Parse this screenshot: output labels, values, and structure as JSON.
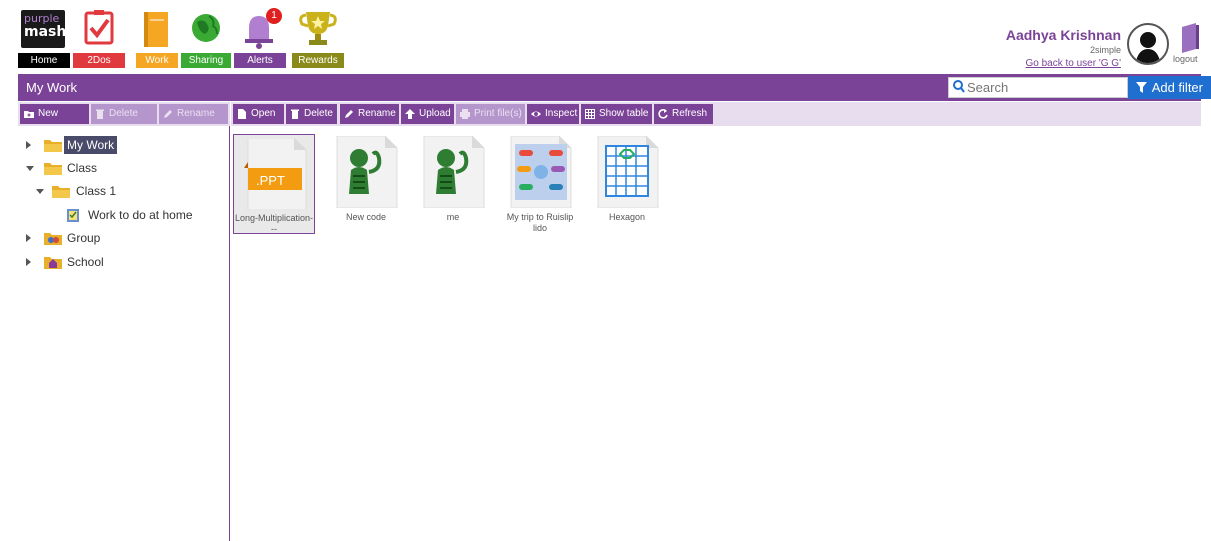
{
  "nav": {
    "items": [
      {
        "label": "Home",
        "icon": "purple-mash-logo-icon",
        "color": "#000000"
      },
      {
        "label": "2Dos",
        "icon": "checkbox-icon",
        "color": "#e03a3e"
      },
      {
        "label": "Work",
        "icon": "notebook-icon",
        "color": "#f5a623"
      },
      {
        "label": "Sharing",
        "icon": "globe-icon",
        "color": "#3aaa35"
      },
      {
        "label": "Alerts",
        "icon": "bell-icon",
        "color": "#7b4397",
        "badge": "1"
      },
      {
        "label": "Rewards",
        "icon": "trophy-icon",
        "color": "#8a8a1a"
      }
    ],
    "logo_text_top": "purple",
    "logo_text_bottom": "mash"
  },
  "user": {
    "name": "Aadhya Krishnan",
    "school": "2simple",
    "back_link": "Go back to user 'G G'",
    "logout_label": "logout"
  },
  "titlebar": {
    "title": "My Work",
    "search_placeholder": "Search",
    "add_filter_label": "Add filter"
  },
  "left_toolbar": {
    "new_label": "New",
    "delete_label": "Delete",
    "rename_label": "Rename"
  },
  "right_toolbar": {
    "open_label": "Open",
    "delete_label": "Delete",
    "rename_label": "Rename",
    "upload_label": "Upload",
    "print_label": "Print file(s)",
    "inspect_label": "Inspect",
    "show_table_label": "Show table",
    "refresh_label": "Refresh"
  },
  "tree": {
    "my_work": "My Work",
    "class": "Class",
    "class_1": "Class 1",
    "work_to_do": "Work to do at home",
    "group": "Group",
    "school": "School"
  },
  "files": [
    {
      "name": "Long-Multiplication---",
      "type": "PPT",
      "selected": true
    },
    {
      "name": "New code",
      "type": "code"
    },
    {
      "name": "me",
      "type": "code"
    },
    {
      "name": "My trip to Ruislip lido",
      "type": "mindmap"
    },
    {
      "name": "Hexagon",
      "type": "grid"
    }
  ],
  "ppt_label": ".PPT",
  "colors": {
    "brand_purple": "#7b4397",
    "filter_blue": "#1e6fd0"
  }
}
